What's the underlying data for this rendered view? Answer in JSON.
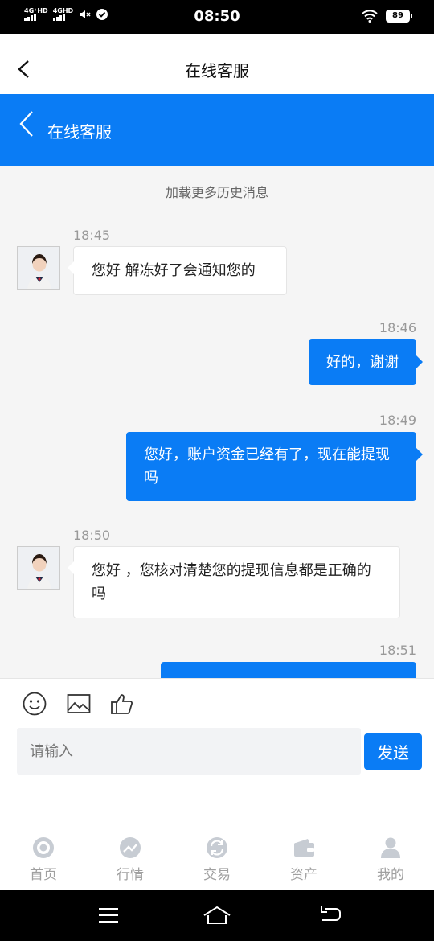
{
  "status_bar": {
    "time": "08:50",
    "network1": "4G⁺HD",
    "network2": "4GHD",
    "battery": "89"
  },
  "header": {
    "title": "在线客服"
  },
  "chat_header": {
    "title": "在线客服"
  },
  "chat": {
    "load_more": "加载更多历史消息",
    "messages": [
      {
        "time": "18:45",
        "direction": "incoming",
        "text": "您好 解冻好了会通知您的"
      },
      {
        "time": "18:46",
        "direction": "outgoing",
        "text": "好的，谢谢"
      },
      {
        "time": "18:49",
        "direction": "outgoing",
        "text": "您好，账户资金已经有了，现在能提现吗"
      },
      {
        "time": "18:50",
        "direction": "incoming",
        "text": "您好 ，您核对清楚您的提现信息都是正确的吗"
      },
      {
        "time": "18:51",
        "direction": "outgoing",
        "text": ""
      }
    ]
  },
  "composer": {
    "placeholder": "请输入",
    "send_label": "发送",
    "tools": [
      "emoji-icon",
      "image-icon",
      "thumbs-up-icon"
    ]
  },
  "tabbar": {
    "items": [
      {
        "label": "首页",
        "icon": "home-icon"
      },
      {
        "label": "行情",
        "icon": "market-icon"
      },
      {
        "label": "交易",
        "icon": "trade-icon"
      },
      {
        "label": "资产",
        "icon": "wallet-icon"
      },
      {
        "label": "我的",
        "icon": "profile-icon"
      }
    ]
  },
  "colors": {
    "accent": "#0a7cf5",
    "tab_inactive": "#a0a0a0",
    "chat_bg": "#f5f5f5"
  }
}
